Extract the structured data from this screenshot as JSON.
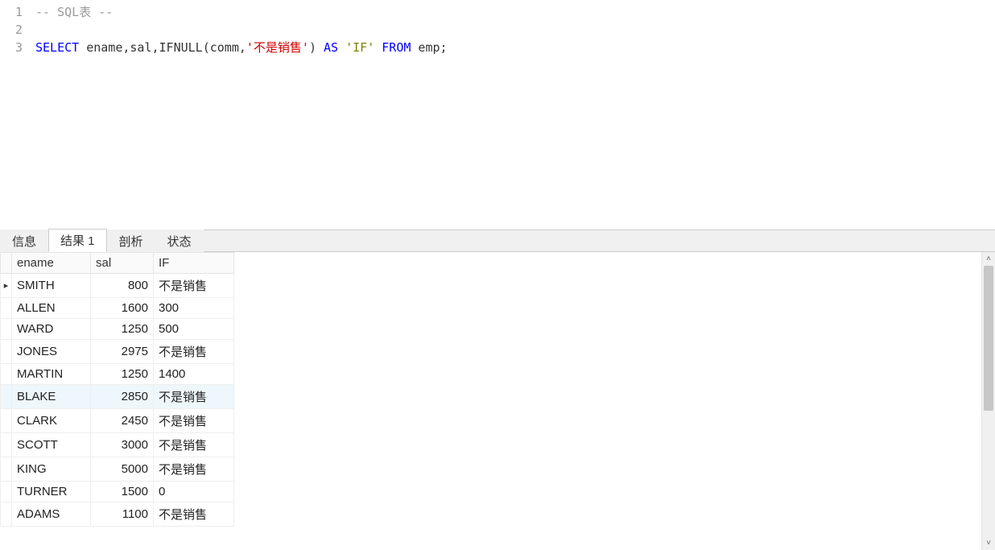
{
  "editor": {
    "lines": [
      {
        "num": "1",
        "tokens": [
          {
            "cls": "tok-comment",
            "text": "-- SQL表 --"
          }
        ]
      },
      {
        "num": "2",
        "tokens": []
      },
      {
        "num": "3",
        "tokens": [
          {
            "cls": "tok-keyword",
            "text": "SELECT"
          },
          {
            "cls": "tok-ident",
            "text": " ename,sal,IFNULL(comm,"
          },
          {
            "cls": "tok-string",
            "text": "'不是销售'"
          },
          {
            "cls": "tok-ident",
            "text": ") "
          },
          {
            "cls": "tok-keyword",
            "text": "AS"
          },
          {
            "cls": "tok-ident",
            "text": " "
          },
          {
            "cls": "tok-string2",
            "text": "'IF'"
          },
          {
            "cls": "tok-ident",
            "text": " "
          },
          {
            "cls": "tok-keyword",
            "text": "FROM"
          },
          {
            "cls": "tok-ident",
            "text": " emp;"
          }
        ]
      }
    ]
  },
  "tabs": {
    "items": [
      {
        "label": "信息",
        "active": false
      },
      {
        "label": "结果 1",
        "active": true
      },
      {
        "label": "剖析",
        "active": false
      },
      {
        "label": "状态",
        "active": false
      }
    ]
  },
  "results": {
    "columns": [
      "ename",
      "sal",
      "IF"
    ],
    "rows": [
      {
        "marker": "▸",
        "ename": "SMITH",
        "sal": "800",
        "if": "不是销售",
        "hl": false
      },
      {
        "marker": "",
        "ename": "ALLEN",
        "sal": "1600",
        "if": "300",
        "hl": false
      },
      {
        "marker": "",
        "ename": "WARD",
        "sal": "1250",
        "if": "500",
        "hl": false
      },
      {
        "marker": "",
        "ename": "JONES",
        "sal": "2975",
        "if": "不是销售",
        "hl": false
      },
      {
        "marker": "",
        "ename": "MARTIN",
        "sal": "1250",
        "if": "1400",
        "hl": false
      },
      {
        "marker": "",
        "ename": "BLAKE",
        "sal": "2850",
        "if": "不是销售",
        "hl": true
      },
      {
        "marker": "",
        "ename": "CLARK",
        "sal": "2450",
        "if": "不是销售",
        "hl": false
      },
      {
        "marker": "",
        "ename": "SCOTT",
        "sal": "3000",
        "if": "不是销售",
        "hl": false
      },
      {
        "marker": "",
        "ename": "KING",
        "sal": "5000",
        "if": "不是销售",
        "hl": false
      },
      {
        "marker": "",
        "ename": "TURNER",
        "sal": "1500",
        "if": "0",
        "hl": false
      },
      {
        "marker": "",
        "ename": "ADAMS",
        "sal": "1100",
        "if": "不是销售",
        "hl": false
      }
    ]
  },
  "scroll": {
    "up": "˄",
    "down": "˅"
  }
}
